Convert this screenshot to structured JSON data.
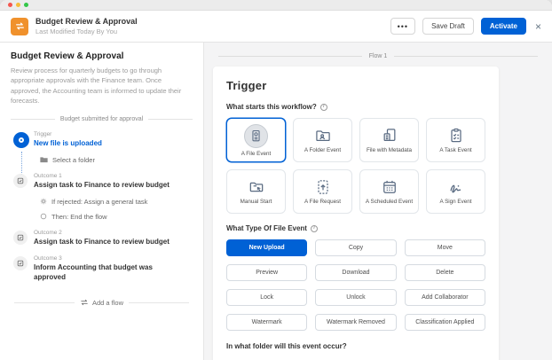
{
  "header": {
    "title": "Budget Review & Approval",
    "subtitle": "Last Modified Today By You",
    "more_label": "•••",
    "save_draft_label": "Save Draft",
    "activate_label": "Activate",
    "close_label": "×"
  },
  "sidebar": {
    "title": "Budget Review & Approval",
    "description": "Review process for quarterly budgets to go through appropriate approvals with the Finance team. Once approved, the Accounting team is informed to update their forecasts.",
    "flow_divider": "Budget submitted for approval",
    "trigger": {
      "label": "Trigger",
      "title": "New file is uploaded",
      "detail": "Select a folder"
    },
    "outcomes": [
      {
        "label": "Outcome 1",
        "title": "Assign task to Finance to review budget",
        "details": [
          {
            "icon": "gear-icon",
            "text": "If rejected: Assign a general task"
          },
          {
            "icon": "circle-icon",
            "text": "Then: End the flow"
          }
        ]
      },
      {
        "label": "Outcome 2",
        "title": "Assign task to Finance to review budget",
        "details": []
      },
      {
        "label": "Outcome 3",
        "title": "Inform Accounting that budget was approved",
        "details": []
      }
    ],
    "add_flow_label": "Add a flow"
  },
  "main": {
    "flow_tab": "Flow 1",
    "card": {
      "title": "Trigger",
      "question_start": "What starts this workflow?",
      "tiles": [
        {
          "label": "A File Event",
          "icon": "file-event-icon",
          "selected": true
        },
        {
          "label": "A Folder Event",
          "icon": "folder-event-icon",
          "selected": false
        },
        {
          "label": "File with Metadata",
          "icon": "file-metadata-icon",
          "selected": false
        },
        {
          "label": "A Task Event",
          "icon": "task-event-icon",
          "selected": false
        },
        {
          "label": "Manual Start",
          "icon": "manual-start-icon",
          "selected": false
        },
        {
          "label": "A File Request",
          "icon": "file-request-icon",
          "selected": false
        },
        {
          "label": "A Scheduled Event",
          "icon": "scheduled-event-icon",
          "selected": false
        },
        {
          "label": "A Sign Event",
          "icon": "sign-event-icon",
          "selected": false
        }
      ],
      "question_type": "What Type Of File Event",
      "file_event_types": [
        {
          "label": "New Upload",
          "selected": true
        },
        {
          "label": "Copy",
          "selected": false
        },
        {
          "label": "Move",
          "selected": false
        },
        {
          "label": "Preview",
          "selected": false
        },
        {
          "label": "Download",
          "selected": false
        },
        {
          "label": "Delete",
          "selected": false
        },
        {
          "label": "Lock",
          "selected": false
        },
        {
          "label": "Unlock",
          "selected": false
        },
        {
          "label": "Add Collaborator",
          "selected": false
        },
        {
          "label": "Watermark",
          "selected": false
        },
        {
          "label": "Watermark Removed",
          "selected": false
        },
        {
          "label": "Classification Applied",
          "selected": false
        }
      ],
      "question_folder": "In what folder will this event occur?"
    }
  },
  "colors": {
    "accent_blue": "#0061d5",
    "brand_orange": "#f0912c",
    "traffic_red": "#f5564e",
    "traffic_yellow": "#f6bd3b",
    "traffic_green": "#34c748"
  }
}
